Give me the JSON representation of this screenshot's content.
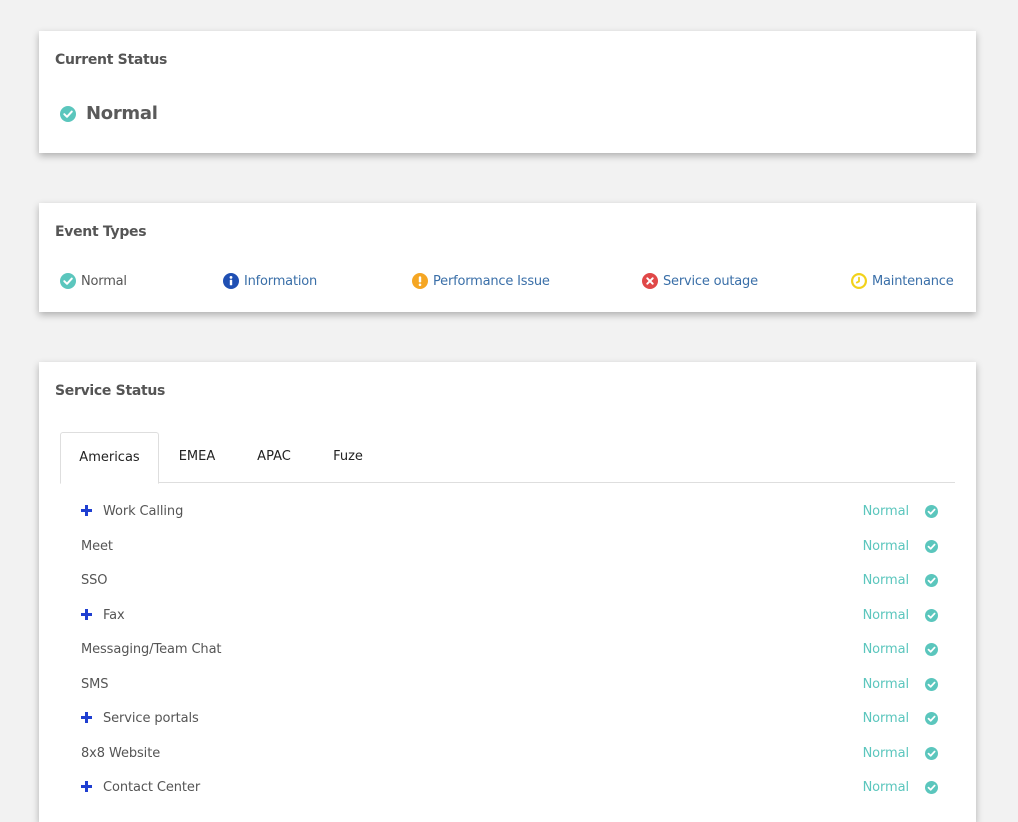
{
  "current_status": {
    "title": "Current Status",
    "value": "Normal"
  },
  "event_types": {
    "title": "Event Types",
    "items": [
      {
        "label": "Normal",
        "icon": "check-circle-icon",
        "color": "#5bc6bd"
      },
      {
        "label": "Information",
        "icon": "info-circle-icon",
        "color": "#1f4fb3"
      },
      {
        "label": "Performance Issue",
        "icon": "exclamation-circle-icon",
        "color": "#f5a623"
      },
      {
        "label": "Service outage",
        "icon": "x-circle-icon",
        "color": "#e04848"
      },
      {
        "label": "Maintenance",
        "icon": "clock-icon",
        "color": "#f2d21b"
      }
    ]
  },
  "service_status": {
    "title": "Service Status",
    "tabs": [
      "Americas",
      "EMEA",
      "APAC",
      "Fuze"
    ],
    "active_tab": "Americas",
    "services": [
      {
        "name": "Work Calling",
        "expandable": true,
        "status": "Normal"
      },
      {
        "name": "Meet",
        "expandable": false,
        "status": "Normal"
      },
      {
        "name": "SSO",
        "expandable": false,
        "status": "Normal"
      },
      {
        "name": "Fax",
        "expandable": true,
        "status": "Normal"
      },
      {
        "name": "Messaging/Team Chat",
        "expandable": false,
        "status": "Normal"
      },
      {
        "name": "SMS",
        "expandable": false,
        "status": "Normal"
      },
      {
        "name": "Service portals",
        "expandable": true,
        "status": "Normal"
      },
      {
        "name": "8x8 Website",
        "expandable": false,
        "status": "Normal"
      },
      {
        "name": "Contact Center",
        "expandable": true,
        "status": "Normal"
      }
    ]
  },
  "colors": {
    "normal": "#5bc6bd",
    "link": "#3a6fa8",
    "plus": "#1f3fd1"
  }
}
